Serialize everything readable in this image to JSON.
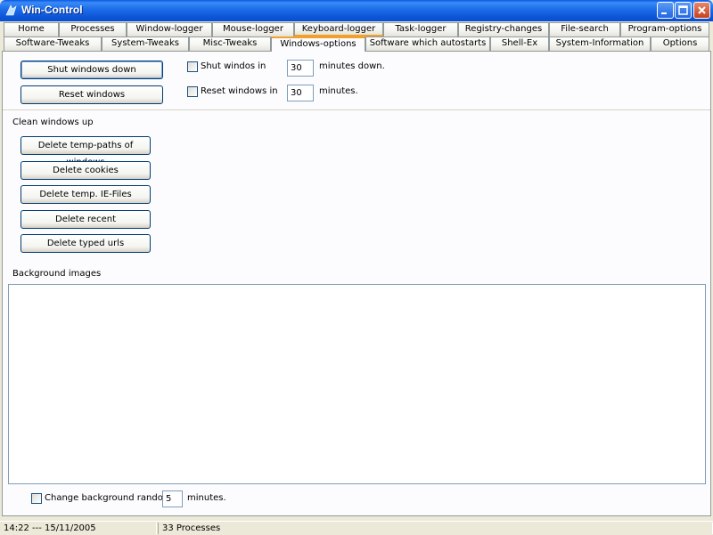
{
  "window": {
    "title": "Win-Control"
  },
  "tabs_row1": [
    "Home",
    "Processes",
    "Window-logger",
    "Mouse-logger",
    "Keyboard-logger",
    "Task-logger",
    "Registry-changes",
    "File-search",
    "Program-options"
  ],
  "tabs_row2": [
    "Software-Tweaks",
    "System-Tweaks",
    "Misc-Tweaks",
    "Windows-options",
    "Software which autostarts",
    "Shell-Ex",
    "System-Information",
    "Options"
  ],
  "active_tab": "Windows-options",
  "shutdown": {
    "shut_button": "Shut windows down",
    "reset_button": "Reset windows",
    "shut_check_label": "Shut windos in",
    "shut_minutes": "30",
    "shut_suffix": "minutes down.",
    "reset_check_label": "Reset windows in",
    "reset_minutes": "30",
    "reset_suffix": "minutes."
  },
  "clean": {
    "heading": "Clean windows up",
    "buttons": [
      "Delete temp-paths of windows",
      "Delete cookies",
      "Delete temp. IE-Files",
      "Delete recent",
      "Delete typed urls"
    ]
  },
  "background": {
    "heading": "Background images",
    "random_label": "Change background randomly",
    "random_minutes": "5",
    "random_suffix": "minutes."
  },
  "status": {
    "datetime": "14:22 --- 15/11/2005",
    "processes": "33 Processes"
  },
  "colors": {
    "titlebar": "#0A58E6",
    "active_tab_accent": "#F1A02B",
    "face": "#ECE9D8"
  }
}
